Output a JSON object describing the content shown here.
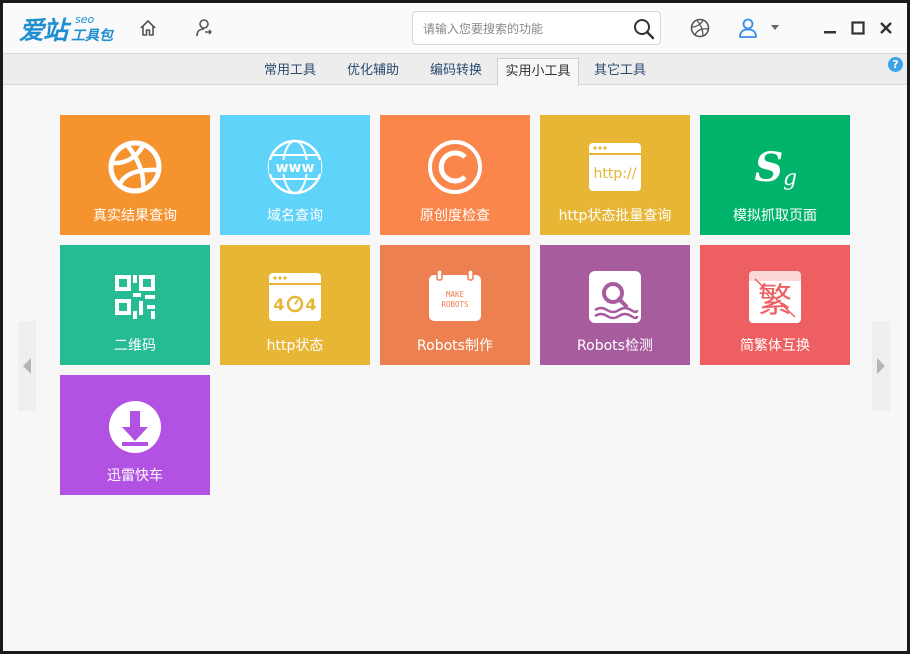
{
  "app": {
    "logo_main": "爱站",
    "logo_seo": "seo",
    "logo_sub": "工具包"
  },
  "toolbar": {
    "search_placeholder": "请输入您要搜索的功能"
  },
  "tabs": [
    {
      "label": "常用工具"
    },
    {
      "label": "优化辅助"
    },
    {
      "label": "编码转换"
    },
    {
      "label": "实用小工具",
      "active": true
    },
    {
      "label": "其它工具"
    }
  ],
  "help_label": "?",
  "tiles": [
    {
      "label": "真实结果查询",
      "color": "#f5932f",
      "icon": "basketball-icon"
    },
    {
      "label": "域名查询",
      "color": "#5fd3fa",
      "icon": "www-globe-icon"
    },
    {
      "label": "原创度检查",
      "color": "#fb864b",
      "icon": "copyright-icon"
    },
    {
      "label": "http状态批量查询",
      "color": "#e8b635",
      "icon": "browser-http-icon"
    },
    {
      "label": "模拟抓取页面",
      "color": "#00b36a",
      "icon": "sogou-icon"
    },
    {
      "label": "二维码",
      "color": "#27bb93",
      "icon": "qrcode-icon"
    },
    {
      "label": "http状态",
      "color": "#e8b635",
      "icon": "browser-404-icon"
    },
    {
      "label": "Robots制作",
      "color": "#ec8050",
      "icon": "make-robots-icon"
    },
    {
      "label": "Robots检测",
      "color": "#a75c9e",
      "icon": "robots-check-icon"
    },
    {
      "label": "简繁体互换",
      "color": "#ee5f62",
      "icon": "traditional-char-icon"
    },
    {
      "label": "迅雷快车",
      "color": "#b152e2",
      "icon": "download-icon"
    }
  ],
  "tile_icon_texts": {
    "www": "www",
    "http": "http://",
    "s": "S",
    "g": "g",
    "four_left": "4",
    "four_right": "4",
    "make": "MAKE",
    "robots": "ROBOTS",
    "fan": "繁"
  }
}
